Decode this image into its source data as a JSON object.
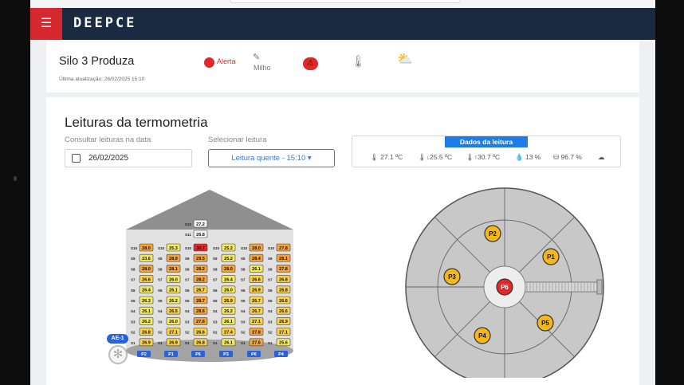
{
  "header": {
    "logo": "DEEPCE",
    "menu_icon": "hamburger-icon"
  },
  "silo": {
    "title": "Silo 3 Produza",
    "updated": "Última atualização: 26/02/2025 15:10",
    "alert_label": "Alerta",
    "grain_label": "Milho",
    "alert_color": "#e02a2a",
    "icons": [
      "alert-dot-icon",
      "grain-icon",
      "warning-triangle-icon",
      "thermometer-icon",
      "weather-icon"
    ]
  },
  "section": {
    "title": "Leituras da termometria",
    "date_label": "Consultar leituras na data",
    "date_value": "26/02/2025",
    "select_label": "Selecionar leitura",
    "select_value": "Leitura quente - 15:10 ▾"
  },
  "reading": {
    "header": "Dados da leitura",
    "temp": "27.1 ºC",
    "temp_low": "25.5 ºC",
    "temp_high": "30.7 ºC",
    "humidity": "13 %",
    "volume": "96.7 %"
  },
  "cables": {
    "fan_label": "AE-1",
    "labels": [
      "P2",
      "P1",
      "P6",
      "P3",
      "P6",
      "P4"
    ],
    "sensor_labels": [
      "S10",
      "S9",
      "S8",
      "S7",
      "S6",
      "S5",
      "S4",
      "S3",
      "S2",
      "S1"
    ],
    "columns": [
      [
        "28.0",
        "23.6",
        "28.0",
        "26.6",
        "26.4",
        "26.3",
        "26.1",
        "26.2",
        "26.8",
        "26.9"
      ],
      [
        "25.3",
        "28.9",
        "28.1",
        "26.0",
        "26.1",
        "26.2",
        "26.5",
        "26.0",
        "27.1",
        "26.9"
      ],
      [
        "30.7",
        "29.5",
        "28.2",
        "28.2",
        "26.7",
        "28.7",
        "28.6",
        "27.6",
        "26.6",
        "26.8"
      ],
      [
        "25.2",
        "25.2",
        "28.0",
        "26.4",
        "26.0",
        "26.9",
        "26.2",
        "26.1",
        "27.4",
        "26.1"
      ],
      [
        "28.0",
        "28.4",
        "26.1",
        "26.6",
        "26.9",
        "26.7",
        "26.7",
        "27.1",
        "27.8",
        "27.6"
      ],
      [
        "27.8",
        "28.1",
        "27.8",
        "26.8",
        "26.8",
        "26.6",
        "26.6",
        "26.9",
        "27.1",
        "25.6"
      ]
    ],
    "top_extra": [
      {
        "sensor": "S12",
        "value": "27.2"
      },
      {
        "sensor": "S11",
        "value": "26.8"
      }
    ]
  },
  "plan": {
    "points": [
      "P2",
      "P1",
      "P3",
      "P6",
      "P4",
      "P5"
    ],
    "hot_color": "#e02a2a",
    "point_color": "#f2b71a"
  }
}
